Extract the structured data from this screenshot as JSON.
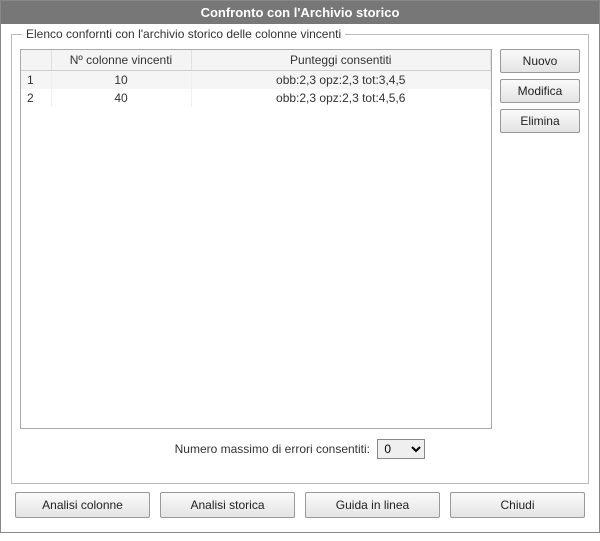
{
  "window": {
    "title": "Confronto con l'Archivio storico"
  },
  "fieldset": {
    "legend": "Elenco confornti con l'archivio storico delle colonne vincenti"
  },
  "table": {
    "headers": {
      "idx": "",
      "col1": "Nº colonne vincenti",
      "col2": "Punteggi consentiti"
    },
    "rows": [
      {
        "idx": "1",
        "col1": "10",
        "col2": "obb:2,3 opz:2,3 tot:3,4,5"
      },
      {
        "idx": "2",
        "col1": "40",
        "col2": "obb:2,3 opz:2,3 tot:4,5,6"
      }
    ]
  },
  "side": {
    "nuovo": "Nuovo",
    "modifica": "Modifica",
    "elimina": "Elimina"
  },
  "errors": {
    "label": "Numero massimo di errori consentiti:",
    "value": "0"
  },
  "footer": {
    "analisi_colonne": "Analisi colonne",
    "analisi_storica": "Analisi storica",
    "guida": "Guida in linea",
    "chiudi": "Chiudi"
  }
}
